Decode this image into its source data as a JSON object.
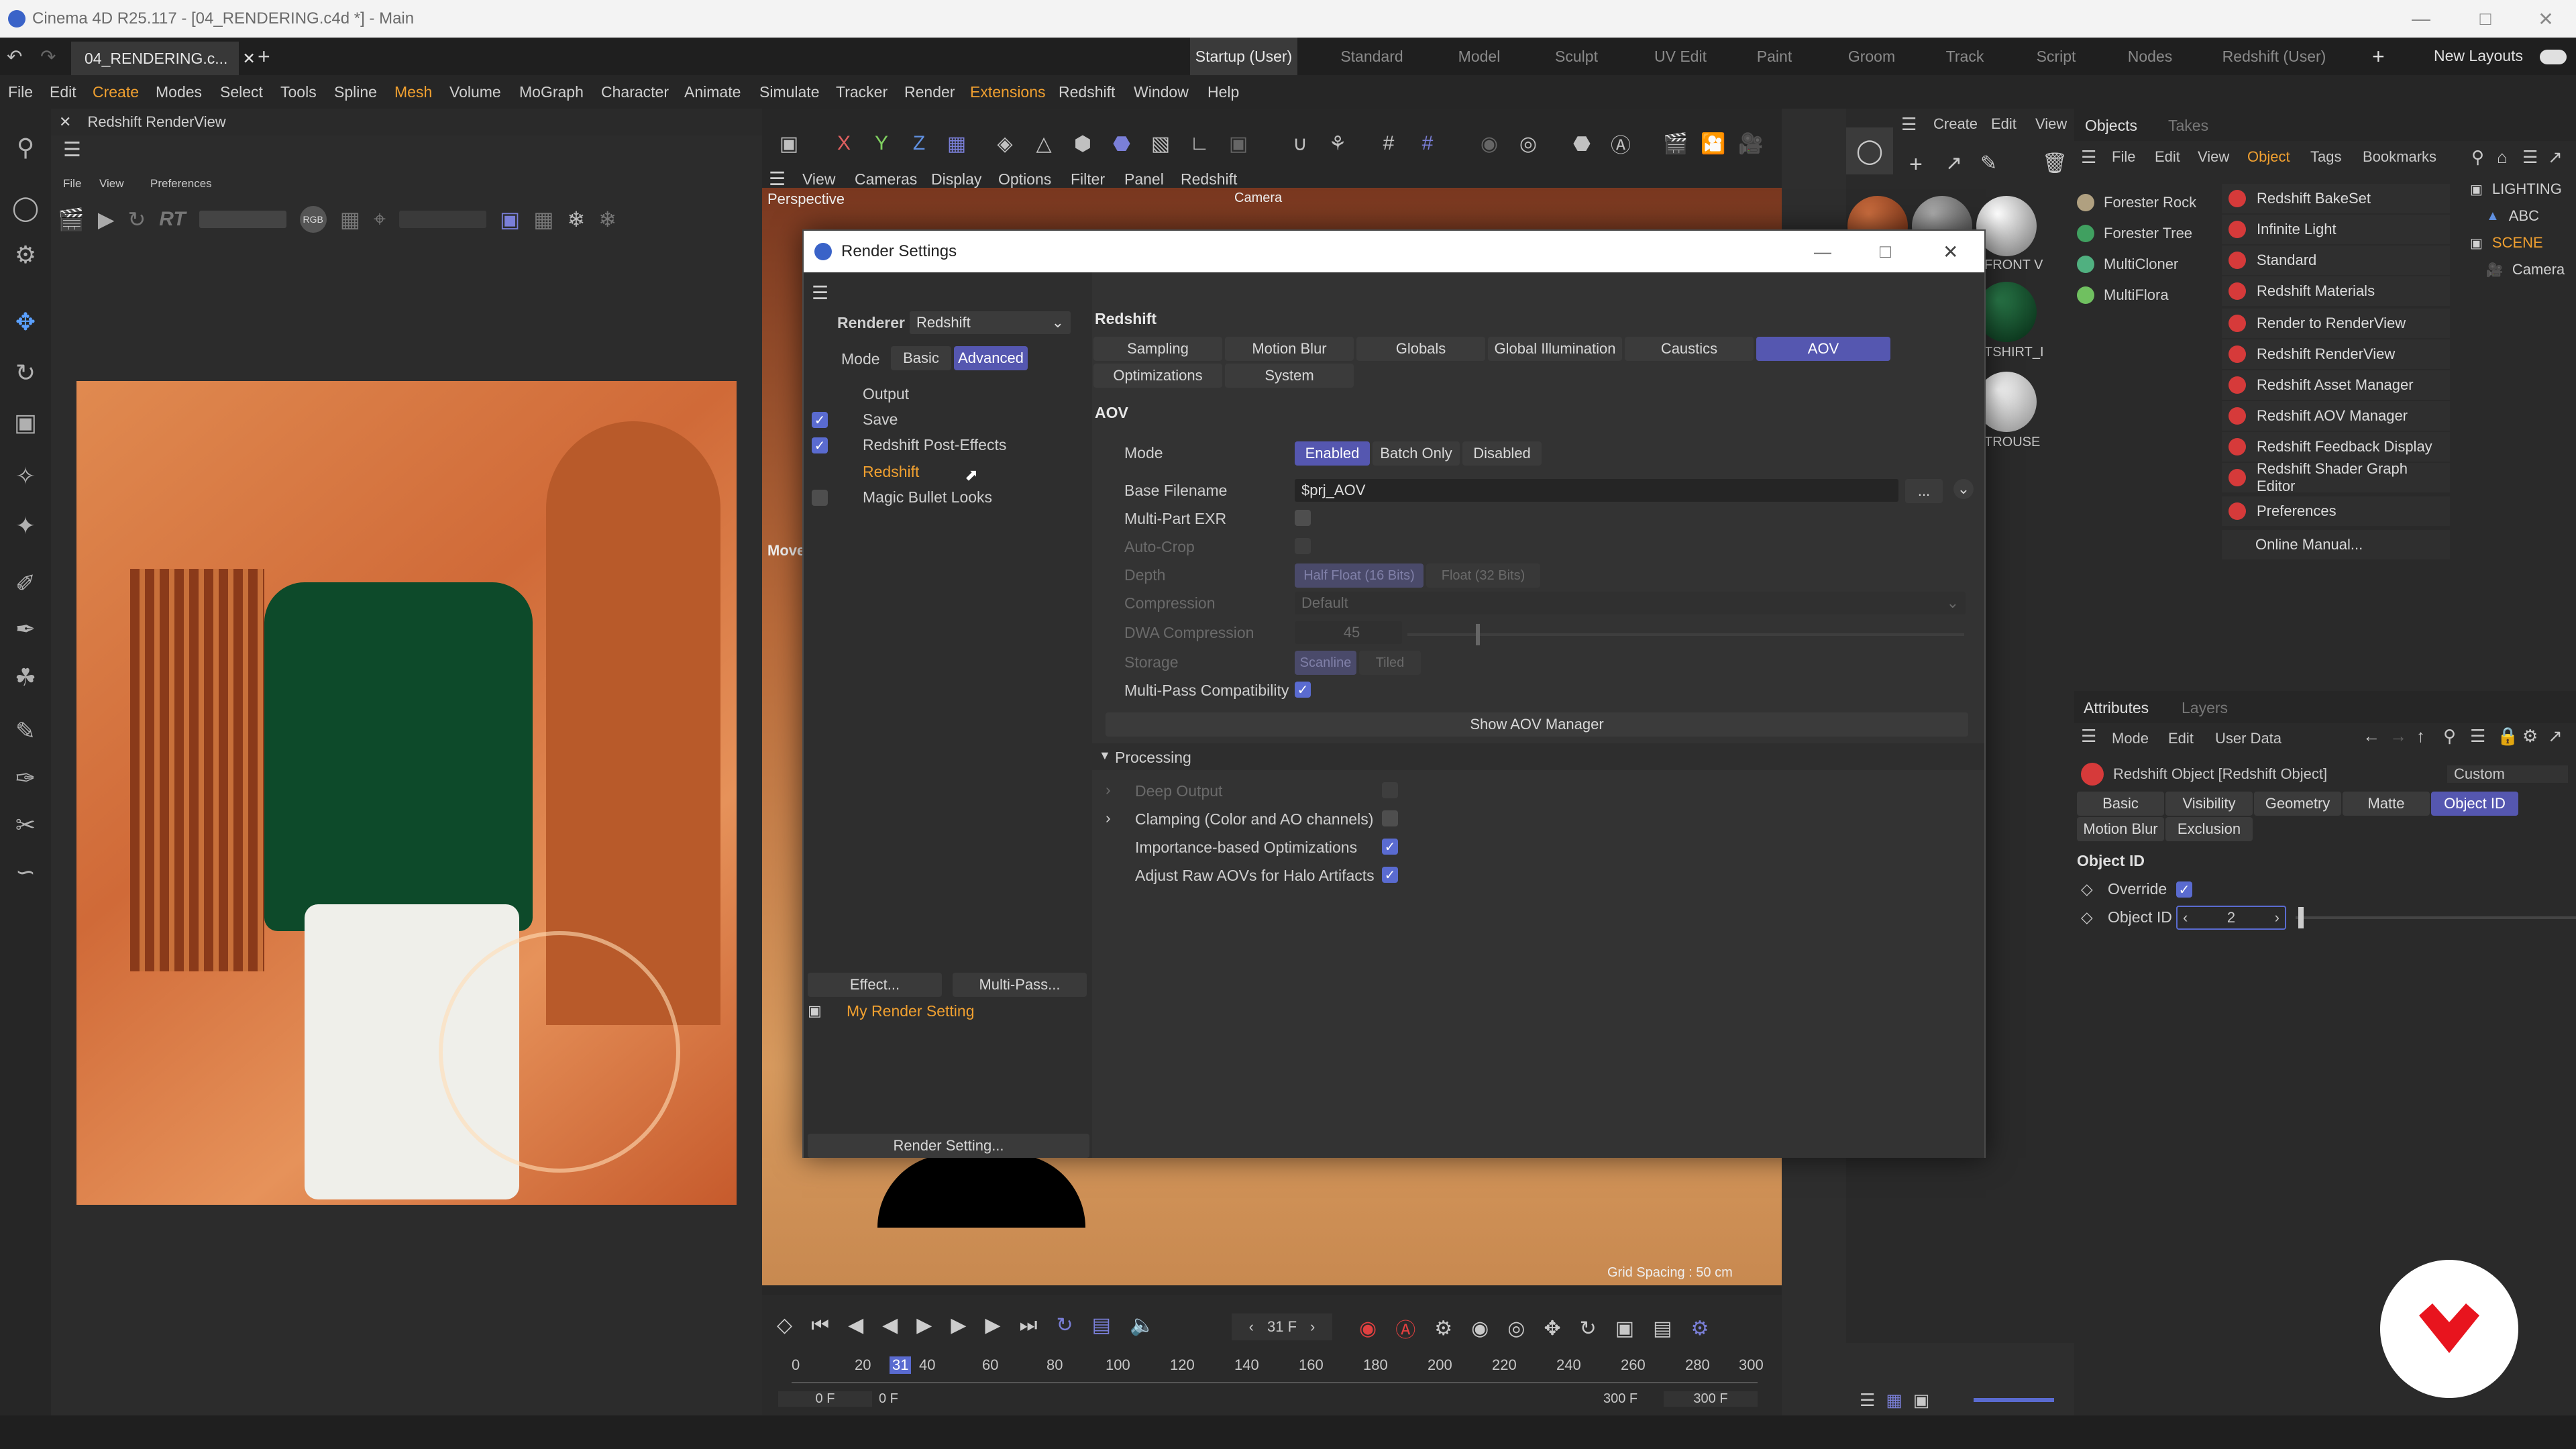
{
  "app": {
    "window_title": "Cinema 4D R25.117 - [04_RENDERING.c4d *] - Main"
  },
  "tabbar": {
    "doc_tab": "04_RENDERING.c...",
    "layouts": [
      "Startup (User)",
      "Standard",
      "Model",
      "Sculpt",
      "UV Edit",
      "Paint",
      "Groom",
      "Track",
      "Script",
      "Nodes",
      "Redshift (User)"
    ],
    "active_layout": "Startup (User)",
    "new_layouts": "New Layouts"
  },
  "menubar": [
    "File",
    "Edit",
    "Create",
    "Modes",
    "Select",
    "Tools",
    "Spline",
    "Mesh",
    "Volume",
    "MoGraph",
    "Character",
    "Animate",
    "Simulate",
    "Tracker",
    "Render",
    "Extensions",
    "Redshift",
    "Window",
    "Help"
  ],
  "renderview": {
    "title": "Redshift RenderView",
    "menu": [
      "File",
      "View",
      "Preferences"
    ],
    "rt_label": "RT",
    "rgb_label": "RGB"
  },
  "viewport": {
    "menus": [
      "View",
      "Cameras",
      "Display",
      "Options",
      "Filter",
      "Panel",
      "Redshift"
    ],
    "label": "Perspective",
    "camera_label": "Camera",
    "move_label": "Move",
    "grid_spacing": "Grid Spacing : 50 cm"
  },
  "timeline": {
    "current_frame": "31 F",
    "ticks": [
      "0",
      "20",
      "40",
      "60",
      "80",
      "100",
      "120",
      "140",
      "160",
      "180",
      "200",
      "220",
      "240",
      "260",
      "280",
      "300"
    ],
    "playhead": "31",
    "start_field": "0 F",
    "start_field2": "0 F",
    "end_field": "300 F",
    "end_field2": "300 F"
  },
  "materials_panel": {
    "menus": [
      "Create",
      "Edit",
      "View"
    ],
    "materials": [
      "FRONT V",
      "TSHIRT_I",
      "TROUSE"
    ]
  },
  "objects_panel": {
    "tabs": [
      "Objects",
      "Takes"
    ],
    "menus": [
      "File",
      "Edit",
      "View",
      "Object",
      "Tags",
      "Bookmarks"
    ],
    "objects": [
      "Forester Rock",
      "Forester Tree",
      "MultiCloner",
      "MultiFlora"
    ],
    "scene_tree": [
      "LIGHTING",
      "ABC",
      "SCENE",
      "Camera"
    ]
  },
  "redshift_menu": {
    "items": [
      "Redshift BakeSet",
      "Infinite Light",
      "Standard",
      "Redshift Materials",
      "Render to RenderView",
      "Redshift RenderView",
      "Redshift Asset Manager",
      "Redshift AOV Manager",
      "Redshift Feedback Display",
      "Redshift Shader Graph Editor",
      "Preferences",
      "Online Manual..."
    ]
  },
  "attributes_panel": {
    "tabs": [
      "Attributes",
      "Layers"
    ],
    "menus": [
      "Mode",
      "Edit",
      "User Data"
    ],
    "object_title": "Redshift Object [Redshift Object]",
    "preset": "Custom",
    "tabs_row1": [
      "Basic",
      "Visibility",
      "Geometry",
      "Matte",
      "Object ID"
    ],
    "tabs_row2": [
      "Motion Blur",
      "Exclusion"
    ],
    "active_tab": "Object ID",
    "section": "Object ID",
    "override_label": "Override",
    "object_id_label": "Object ID",
    "object_id_value": "2"
  },
  "dialog": {
    "title": "Render Settings",
    "renderer_label": "Renderer",
    "renderer_value": "Redshift",
    "mode_label": "Mode",
    "mode_basic": "Basic",
    "mode_advanced": "Advanced",
    "tree": [
      {
        "label": "Output",
        "check": "none"
      },
      {
        "label": "Save",
        "check": "on"
      },
      {
        "label": "Redshift Post-Effects",
        "check": "on"
      },
      {
        "label": "Redshift",
        "check": "none",
        "active": true
      },
      {
        "label": "Magic Bullet Looks",
        "check": "off"
      }
    ],
    "effect_button": "Effect...",
    "multipass_button": "Multi-Pass...",
    "render_setting_item": "My Render Setting",
    "render_setting_button": "Render Setting...",
    "section_title": "Redshift",
    "tabs_row1": [
      "Sampling",
      "Motion Blur",
      "Globals",
      "Global Illumination",
      "Caustics",
      "AOV"
    ],
    "tabs_row2": [
      "Optimizations",
      "System"
    ],
    "active_tab": "AOV",
    "aov_header": "AOV",
    "aov": {
      "mode_label": "Mode",
      "mode_options": [
        "Enabled",
        "Batch Only",
        "Disabled"
      ],
      "base_filename_label": "Base Filename",
      "base_filename_value": "$prj_AOV",
      "browse": "...",
      "multipart_label": "Multi-Part EXR",
      "autocrop_label": "Auto-Crop",
      "depth_label": "Depth",
      "depth_options": [
        "Half Float (16 Bits)",
        "Float (32 Bits)"
      ],
      "compression_label": "Compression",
      "compression_value": "Default",
      "dwa_label": "DWA Compression",
      "dwa_value": "45",
      "storage_label": "Storage",
      "storage_options": [
        "Scanline",
        "Tiled"
      ],
      "multipass_compat_label": "Multi-Pass Compatibility",
      "show_aov_manager": "Show AOV Manager"
    },
    "processing": {
      "header": "Processing",
      "deep_output": "Deep Output",
      "clamping": "Clamping (Color and AO channels)",
      "importance": "Importance-based Optimizations",
      "adjust_raw": "Adjust Raw AOVs for Halo Artifacts"
    }
  },
  "colors": {
    "accent": "#5557b0",
    "highlight_orange": "#f0a030",
    "redshift_red": "#d63a3a"
  }
}
